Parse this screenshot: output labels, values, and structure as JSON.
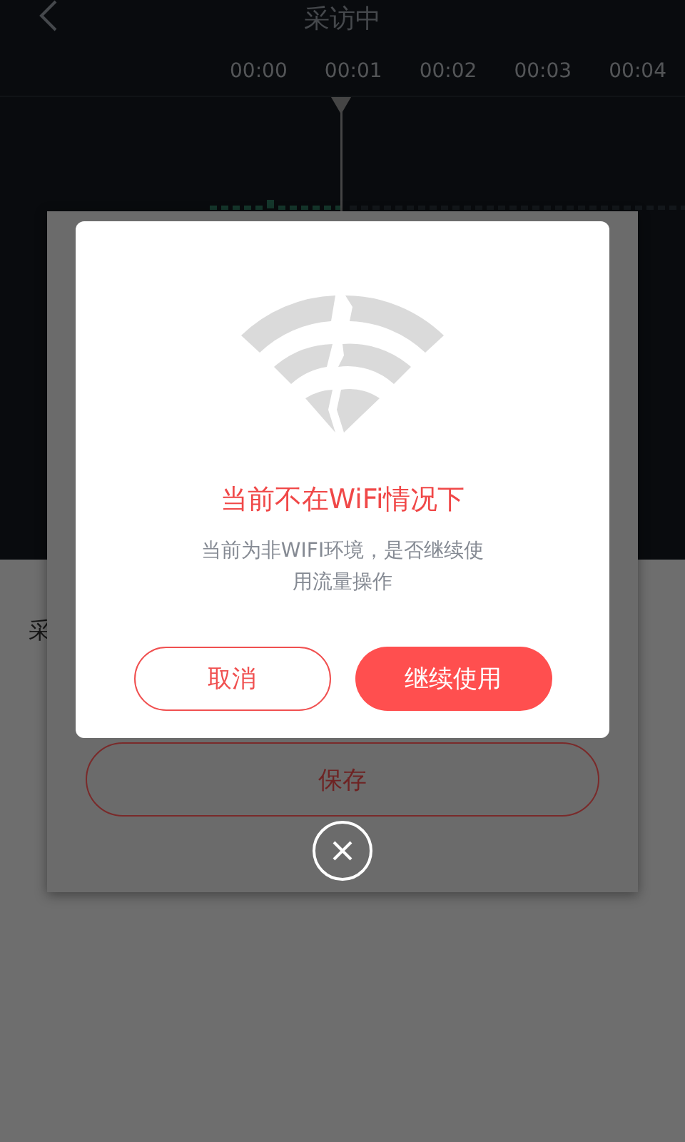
{
  "header": {
    "title": "采访中"
  },
  "timeline": {
    "ticks": [
      "00:00",
      "00:01",
      "00:02",
      "00:03",
      "00:04"
    ]
  },
  "page": {
    "label": "采"
  },
  "sheet": {
    "save_button": "保存"
  },
  "dialog": {
    "title": "当前不在WiFi情况下",
    "message": "当前为非WIFI环境，是否继续使用流量操作",
    "buttons": [
      {
        "label": "取消",
        "kind": "outline"
      },
      {
        "label": "继续使用",
        "kind": "filled"
      }
    ]
  }
}
